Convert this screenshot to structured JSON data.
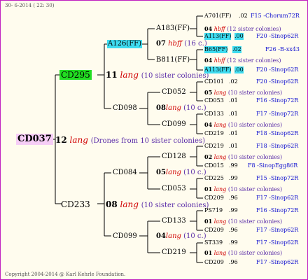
{
  "header": {
    "date": "30-  6-2014 ( 22: 30)"
  },
  "footer": {
    "copyright": "Copyright 2004-2014 @ Karl Kehrle Foundation."
  },
  "root": {
    "id": "CD037",
    "gen": "12",
    "drone": "lang",
    "note": "(Drones from 10 sister colonies)"
  },
  "level1": {
    "top": {
      "id": "CD295",
      "gen": "11",
      "drone": "lang",
      "note": "(10 sister colonies)"
    },
    "bottom": {
      "id": "CD233",
      "gen": "08",
      "drone": "lang",
      "note": "(10 sister colonies)"
    }
  },
  "level2": {
    "a126": {
      "id": "A126(FF)",
      "gen": "07",
      "drone": "hbff",
      "note": "(16 c.)"
    },
    "cd098": {
      "id": "CD098",
      "gen": "08",
      "drone": "lang",
      "note": "(10 c.)"
    },
    "cd084": {
      "id": "CD084",
      "gen": "05",
      "drone": "lang",
      "note": "(10 c.)"
    },
    "cd099": {
      "id": "CD099",
      "gen": "04",
      "drone": "lang",
      "note": "(10 c.)"
    }
  },
  "level3": {
    "a183": {
      "id": "A183(FF)",
      "gen": "04",
      "drone": "hbff",
      "note": "(12 sister colonies)"
    },
    "b811": {
      "id": "B811(FF)",
      "gen": "04",
      "drone": "hbff",
      "note": "(12 sister colonies)"
    },
    "cd052": {
      "id": "CD052",
      "gen": "05",
      "drone": "lang",
      "note": "(10 sister colonies)"
    },
    "cd099b": {
      "id": "CD099",
      "gen": "04",
      "drone": "lang",
      "note": "(10 sister colonies)"
    },
    "cd128": {
      "id": "CD128",
      "gen": "02",
      "drone": "lang",
      "note": "(10 sister colonies)"
    },
    "cd053": {
      "id": "CD053",
      "gen": "01",
      "drone": "lang",
      "note": "(10 sister colonies)"
    },
    "cd133": {
      "id": "CD133",
      "gen": "01",
      "drone": "lang",
      "note": "(10 sister colonies)"
    },
    "cd219": {
      "id": "CD219",
      "gen": "01",
      "drone": "lang",
      "note": "(10 sister colonies)"
    }
  },
  "level4": [
    {
      "id": "A701(FF)",
      "val": ".02",
      "origin": "F15 -Chorum72R"
    },
    {
      "id": "A113(FF)",
      "val": ".00",
      "origin": "F20 -Sinop62R"
    },
    {
      "id": "B65(FF)",
      "val": ".02",
      "origin": "F26 -B-xx43"
    },
    {
      "id": "A113(FF)",
      "val": ".00",
      "origin": "F20 -Sinop62R"
    },
    {
      "id": "CD101",
      "val": ".02",
      "origin": "F20 -Sinop62R"
    },
    {
      "id": "CD053",
      "val": ".01",
      "origin": "F16 -Sinop72R"
    },
    {
      "id": "CD133",
      "val": ".01",
      "origin": "F17 -Sinop72R"
    },
    {
      "id": "CD219",
      "val": ".01",
      "origin": "F18 -Sinop62R"
    },
    {
      "id": "CD219",
      "val": ".01",
      "origin": "F18 -Sinop62R"
    },
    {
      "id": "CD015",
      "val": ".99",
      "origin": "F8 -SinopEgg86R"
    },
    {
      "id": "CD225",
      "val": ".99",
      "origin": "F15 -Sinop72R"
    },
    {
      "id": "CD209",
      "val": ".96",
      "origin": "F17 -Sinop62R"
    },
    {
      "id": "PS719",
      "val": ".99",
      "origin": "F16 -Sinop72R"
    },
    {
      "id": "CD209",
      "val": ".96",
      "origin": "F17 -Sinop62R"
    },
    {
      "id": "ST339",
      "val": ".99",
      "origin": "F17 -Sinop62R"
    },
    {
      "id": "CD209",
      "val": ".96",
      "origin": "F17 -Sinop62R"
    }
  ]
}
